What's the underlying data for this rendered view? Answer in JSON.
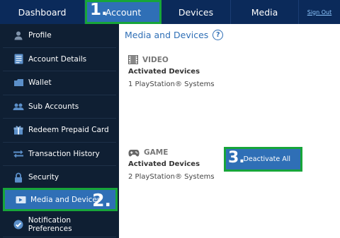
{
  "topnav": {
    "tabs": [
      {
        "label": "Dashboard"
      },
      {
        "label": "Account",
        "step": "1."
      },
      {
        "label": "Devices"
      },
      {
        "label": "Media"
      }
    ],
    "signout_label": "Sign Out"
  },
  "sidebar": {
    "items": [
      {
        "label": "Profile",
        "icon": "profile-icon"
      },
      {
        "label": "Account Details",
        "icon": "document-icon"
      },
      {
        "label": "Wallet",
        "icon": "wallet-icon"
      },
      {
        "label": "Sub Accounts",
        "icon": "users-icon"
      },
      {
        "label": "Redeem Prepaid Card",
        "icon": "gift-icon"
      },
      {
        "label": "Transaction History",
        "icon": "transfer-icon"
      },
      {
        "label": "Security",
        "icon": "lock-icon"
      },
      {
        "label": "Media and Devices",
        "icon": "media-icon",
        "step": "2."
      },
      {
        "label": "Notification Preferences",
        "icon": "check-icon"
      }
    ]
  },
  "main": {
    "title": "Media and Devices",
    "help": "?",
    "video": {
      "heading": "VIDEO",
      "subheading": "Activated Devices",
      "value": "1 PlayStation® Systems"
    },
    "game": {
      "heading": "GAME",
      "subheading": "Activated Devices",
      "value": "2 PlayStation® Systems"
    },
    "deactivate_label": "Deactivate All",
    "deactivate_step": "3."
  },
  "colors": {
    "nav_bg": "#0b2a5a",
    "sidebar_bg": "#0f1f33",
    "accent": "#2f6fb6",
    "highlight": "#17a53a"
  }
}
